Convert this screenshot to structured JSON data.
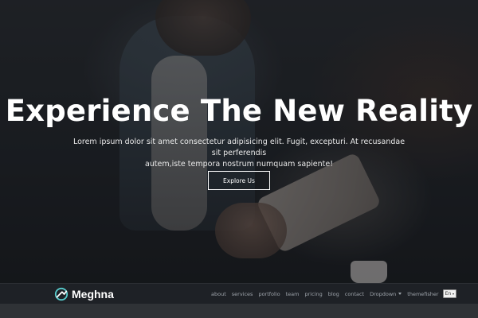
{
  "hero": {
    "title": "Experience The New Reality",
    "text_line1": "Lorem ipsum dolor sit amet consectetur adipisicing elit. Fugit, excepturi. At recusandae sit perferendis",
    "text_line2": "autem,iste tempora nostrum numquam sapiente!",
    "button_label": "Explore Us"
  },
  "navbar": {
    "logo_text": "Meghna",
    "logo_icon": "meghna-logo-icon",
    "items": [
      {
        "label": "about"
      },
      {
        "label": "services"
      },
      {
        "label": "portfolio"
      },
      {
        "label": "team"
      },
      {
        "label": "pricing"
      },
      {
        "label": "blog"
      },
      {
        "label": "contact"
      }
    ],
    "dropdown_label": "Dropdown",
    "themefisher_label": "themefisher",
    "language_value": "En"
  },
  "colors": {
    "accent": "#57cbcc",
    "navbar_bg": "#1e2126",
    "nav_text": "#9ea4ab",
    "hero_title": "#ffffff"
  }
}
